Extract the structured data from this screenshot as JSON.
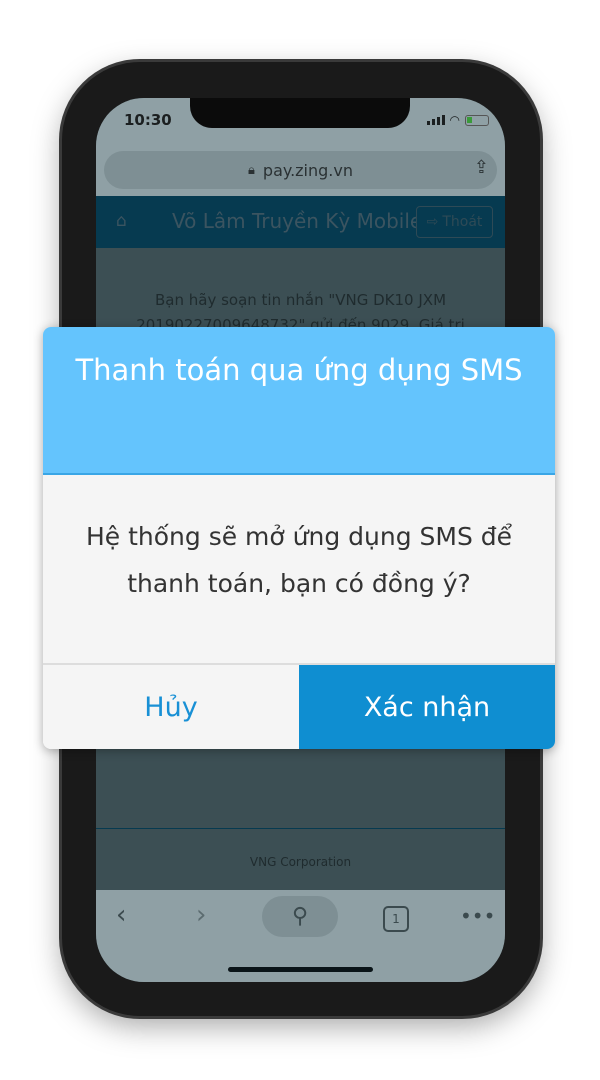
{
  "status_bar": {
    "time": "10:30"
  },
  "browser": {
    "url": "pay.zing.vn"
  },
  "app": {
    "title": "Võ Lâm Truyền Kỳ Mobile",
    "logout_label": "Thoát"
  },
  "content": {
    "message": "Bạn hãy soạn tin nhắn \"VNG DK10 JXM 20190227009648732\" gửi đến 9029. Giá trị"
  },
  "footer": {
    "text": "VNG Corporation"
  },
  "toolbar": {
    "tab_count": "1"
  },
  "dialog": {
    "title": "Thanh toán qua ứng dụng SMS",
    "message": "Hệ thống sẽ mở ứng dụng SMS để thanh toán, bạn có đồng ý?",
    "cancel_label": "Hủy",
    "confirm_label": "Xác nhận"
  },
  "colors": {
    "dialog_header": "#64c4fd",
    "confirm": "#0f8ed1",
    "cancel_text": "#1890d5"
  }
}
